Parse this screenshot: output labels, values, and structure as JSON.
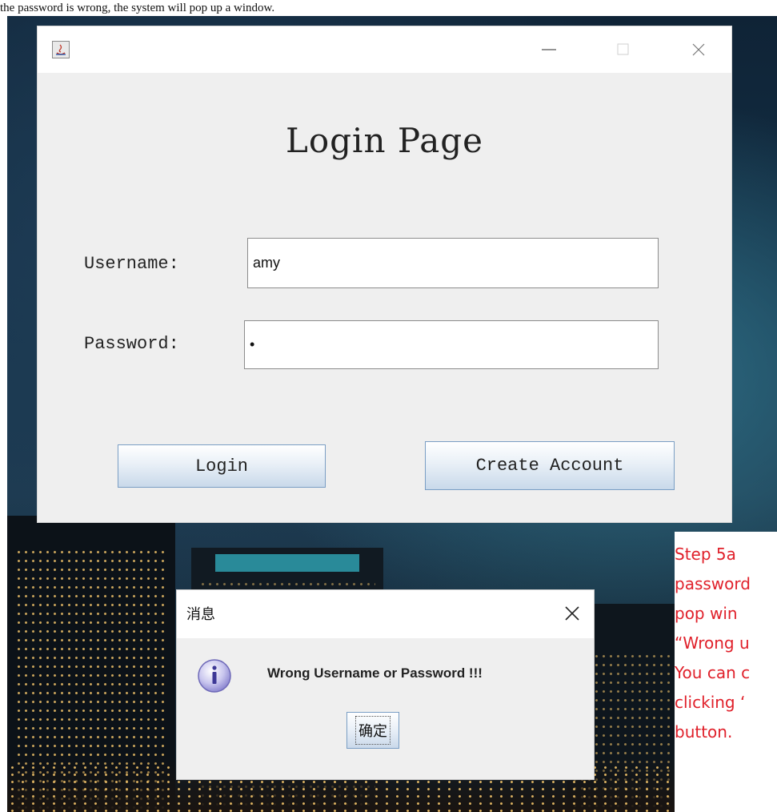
{
  "doc": {
    "intro_text": "the password is wrong, the system will pop up a window."
  },
  "window": {
    "title": "Login Page",
    "username_label": "Username:",
    "password_label": "Password:",
    "username_value": "amy",
    "password_value": "•",
    "login_button": "Login",
    "create_account_button": "Create Account",
    "icons": [
      "java-icon",
      "minimize-icon",
      "maximize-icon",
      "close-icon"
    ]
  },
  "dialog": {
    "title": "消息",
    "message": "Wrong Username or Password !!!",
    "ok_button": "确定",
    "icon": "info-icon"
  },
  "note": {
    "lines": [
      "Step  5a",
      "password",
      "pop  win",
      "“Wrong  u",
      "You can c",
      "clicking  ‘",
      "button."
    ],
    "color": "#e0202a"
  },
  "colors": {
    "window_bg": "#efefef",
    "button_border": "#7a9ec4",
    "annotation": "#e0202a"
  }
}
